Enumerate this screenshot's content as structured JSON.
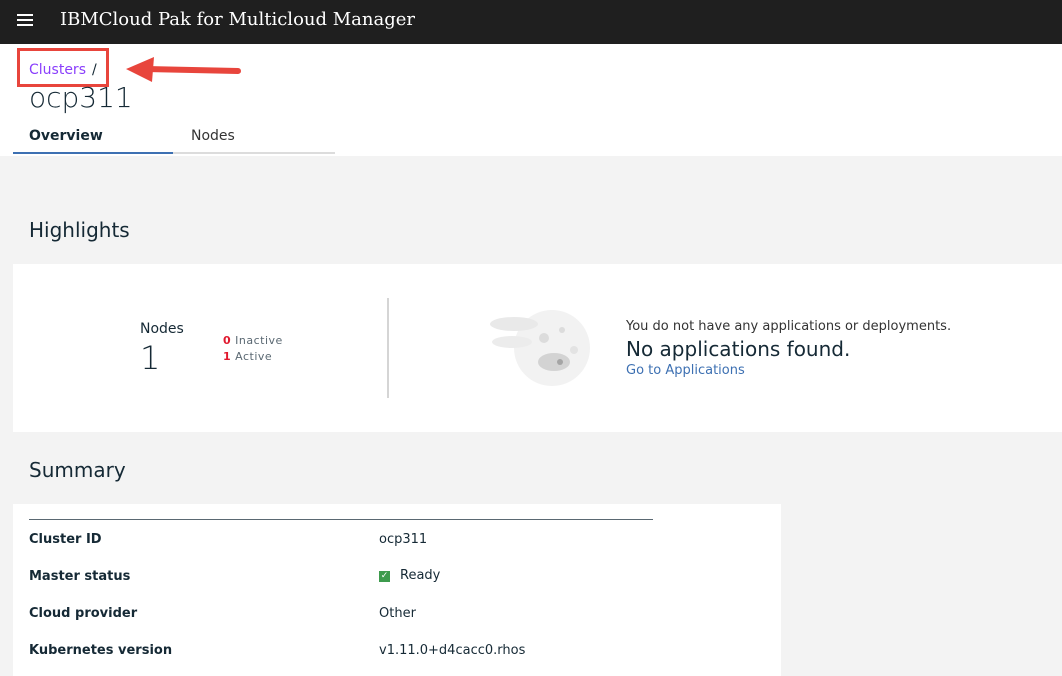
{
  "topbar": {
    "title": "IBMCloud Pak for Multicloud Manager"
  },
  "breadcrumb": {
    "link": "Clusters",
    "separator": "/"
  },
  "page": {
    "title": "ocp311"
  },
  "tabs": [
    {
      "label": "Overview"
    },
    {
      "label": "Nodes"
    }
  ],
  "highlights": {
    "title": "Highlights",
    "nodes": {
      "label": "Nodes",
      "count": "1",
      "inactive_count": "0",
      "inactive_label": "Inactive",
      "active_count": "1",
      "active_label": "Active"
    },
    "applications": {
      "message": "You do not have any applications or deployments.",
      "title": "No applications found.",
      "link": "Go to Applications"
    }
  },
  "summary": {
    "title": "Summary",
    "rows": [
      {
        "label": "Cluster ID",
        "value": "ocp311"
      },
      {
        "label": "Master status",
        "value": "Ready",
        "icon": "checkmark-icon"
      },
      {
        "label": "Cloud provider",
        "value": "Other"
      },
      {
        "label": "Kubernetes version",
        "value": "v1.11.0+d4cacc0.rhos"
      }
    ]
  },
  "colors": {
    "topbar": "#1f1f1f",
    "accent": "#3d70b2",
    "link": "#8a3ffc",
    "alert": "#e0182d",
    "annotation": "#e8453c",
    "success": "#3d9b4d"
  }
}
